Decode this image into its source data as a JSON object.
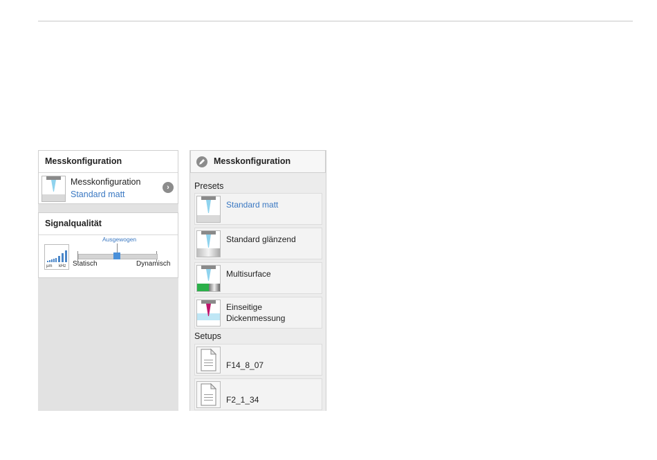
{
  "left": {
    "config_card": {
      "title": "Messkonfiguration",
      "line1": "Messkonfiguration",
      "line2": "Standard matt",
      "arrow_icon": "chevron-right-circle-icon"
    },
    "signal_card": {
      "title": "Signalqualität",
      "icon_label_unit1": "µm",
      "icon_label_unit2": "kHz",
      "slider_value_label": "Ausgewogen",
      "slider_min_label": "Statisch",
      "slider_max_label": "Dynamisch",
      "slider_position": 0.5
    }
  },
  "right": {
    "title": "Messkonfiguration",
    "header_icon": "pencil-icon",
    "presets_label": "Presets",
    "presets": [
      {
        "label": "Standard matt",
        "selected": true
      },
      {
        "label": "Standard glänzend",
        "selected": false
      },
      {
        "label": "Multisurface",
        "selected": false
      },
      {
        "label": "Einseitige Dickenmessung",
        "selected": false
      }
    ],
    "setups_label": "Setups",
    "setups": [
      {
        "label": "F14_8_07",
        "icon": "document-icon"
      },
      {
        "label": "F2_1_34",
        "icon": "document-icon"
      }
    ]
  },
  "colors": {
    "accent_blue": "#3a78c2",
    "slider_thumb": "#4a90d9",
    "sensor_beam": "#8fd3ee",
    "multisurface_green": "#2bb04a",
    "thickness_magenta": "#c0146c"
  }
}
